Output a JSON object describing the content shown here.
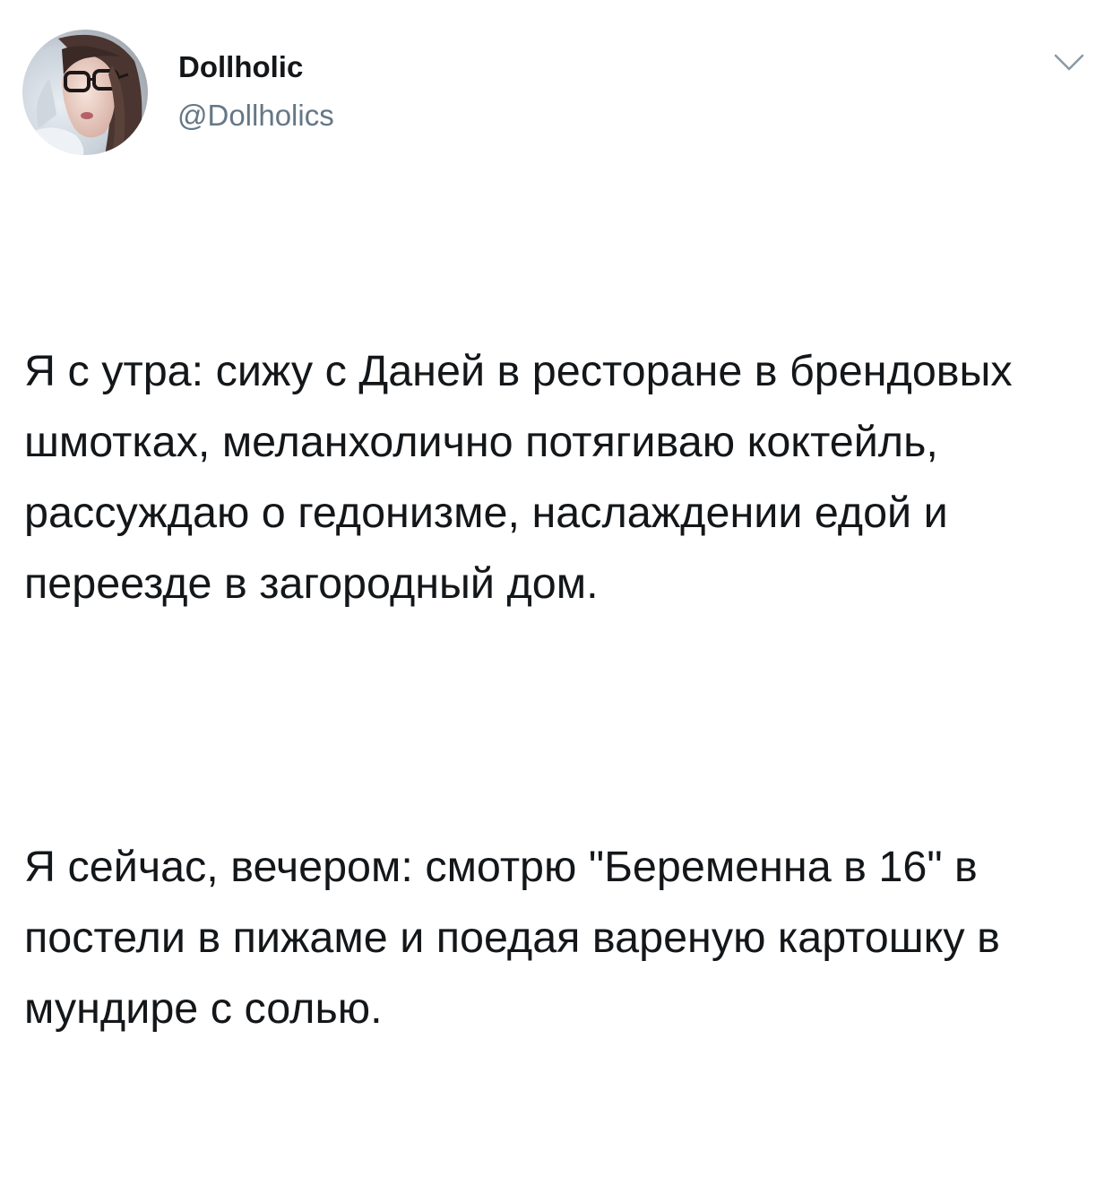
{
  "author": {
    "display_name": "Dollholic",
    "handle": "@Dollholics",
    "avatar_icon": "user-avatar-photo"
  },
  "menu": {
    "icon": "chevron-down-icon"
  },
  "tweet": {
    "paragraphs": [
      "Я с утра: сижу с Даней в ресторане в брендовых шмотках, меланхолично потягиваю коктейль, рассуждаю о гедонизме, наслаждении едой и переезде в загородный дом.",
      "Я сейчас, вечером: смотрю \"Беременна в 16\" в постели в пижаме и поедая вареную картошку в мундире с солью."
    ]
  },
  "colors": {
    "text": "#14171a",
    "secondary": "#657786",
    "chevron": "#8899a6"
  }
}
